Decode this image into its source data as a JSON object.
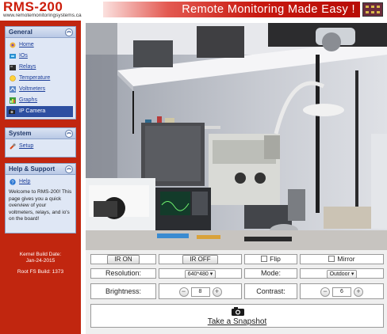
{
  "header": {
    "logo_text": "RMS-200",
    "logo_url": "www.remotemonitoringsystems.ca",
    "banner_text": "Remote Monitoring Made Easy !"
  },
  "sidebar": {
    "general": {
      "title": "General",
      "items": [
        {
          "label": "Home",
          "icon": "home-icon"
        },
        {
          "label": "IOs",
          "icon": "io-icon"
        },
        {
          "label": "Relays",
          "icon": "relay-icon"
        },
        {
          "label": "Temperature",
          "icon": "temperature-icon"
        },
        {
          "label": "Voltmeters",
          "icon": "voltmeter-icon"
        },
        {
          "label": "Graphs",
          "icon": "graph-icon"
        },
        {
          "label": "IP Camera",
          "icon": "camera-icon",
          "active": true
        }
      ]
    },
    "system": {
      "title": "System",
      "items": [
        {
          "label": "Setup",
          "icon": "setup-icon"
        }
      ]
    },
    "help": {
      "title": "Help & Support",
      "items": [
        {
          "label": "Help",
          "icon": "help-icon"
        }
      ],
      "text": "Welcome to RMS-200! This page gives you a quick overview of your voltmeters, relays, and io's on the board!"
    },
    "build": {
      "kernel_label": "Kernel Build Date:",
      "kernel_date": "Jan-24-2015",
      "rootfs": "Root FS Build: 1373"
    }
  },
  "camera": {
    "ir_on": "IR ON",
    "ir_off": "IR OFF",
    "flip": "Flip",
    "mirror": "Mirror",
    "resolution_label": "Resolution:",
    "resolution_value": "640*480",
    "mode_label": "Mode:",
    "mode_value": "Outdoor",
    "brightness_label": "Brightness:",
    "brightness_value": "8",
    "contrast_label": "Contrast:",
    "contrast_value": "6",
    "minus": "−",
    "plus": "+",
    "snapshot": "Take a Snapshot"
  },
  "colors": {
    "brand_red": "#c1260f",
    "panel_blue": "#2d4fa1"
  }
}
